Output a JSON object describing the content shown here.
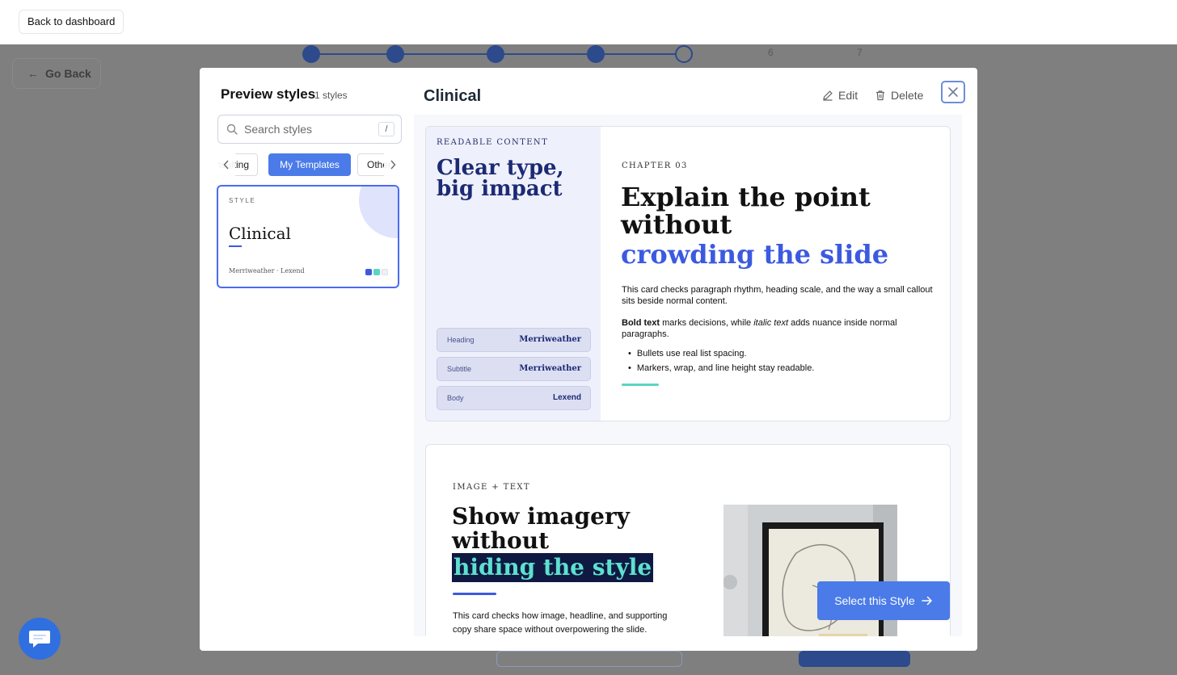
{
  "topbar": {
    "back_label": "Back to dashboard"
  },
  "background": {
    "go_back_label": "Go Back",
    "step_numbers": [
      "6",
      "7"
    ]
  },
  "sidebar": {
    "title": "Preview styles",
    "count": "1 styles",
    "search": {
      "placeholder": "Search styles",
      "shortcut": "/"
    },
    "tabs": [
      {
        "label": "Consulting"
      },
      {
        "label": "My Templates",
        "active": true
      },
      {
        "label": "Other"
      }
    ],
    "style_card": {
      "label": "STYLE",
      "name": "Clinical",
      "fonts": "Merriweather · Lexend",
      "swatches": [
        "#3c5ae0",
        "#5bd5c2",
        "#eef0f6"
      ]
    }
  },
  "main": {
    "title": "Clinical",
    "edit_label": "Edit",
    "delete_label": "Delete",
    "select_label": "Select this Style"
  },
  "slide1": {
    "eyebrow": "READABLE CONTENT",
    "left_heading": "Clear type, big impact",
    "font_rows": [
      {
        "key": "Heading",
        "value": "Merriweather"
      },
      {
        "key": "Subtitle",
        "value": "Merriweather"
      },
      {
        "key": "Body",
        "value": "Lexend"
      }
    ],
    "chapter": "CHAPTER 03",
    "heading_black": "Explain the point without",
    "heading_blue": "crowding the slide",
    "para1": "This card checks paragraph rhythm, heading scale, and the way a small callout sits beside normal content.",
    "para2_bold": "Bold text",
    "para2_mid": " marks decisions, while ",
    "para2_italic": "italic text",
    "para2_end": " adds nuance inside normal paragraphs.",
    "bullets": [
      "Bullets use real list spacing.",
      "Markers, wrap, and line height stay readable."
    ]
  },
  "slide2": {
    "eyebrow": "IMAGE + TEXT",
    "heading_black": "Show imagery without",
    "heading_highlight": "hiding the style",
    "para": "This card checks how image, headline, and supporting copy share space without overpowering the slide."
  },
  "colors": {
    "accent": "#4a7be8",
    "heading_blue": "#3c5ae0",
    "teal": "#5bd5c2",
    "navy": "#1c2a74"
  }
}
